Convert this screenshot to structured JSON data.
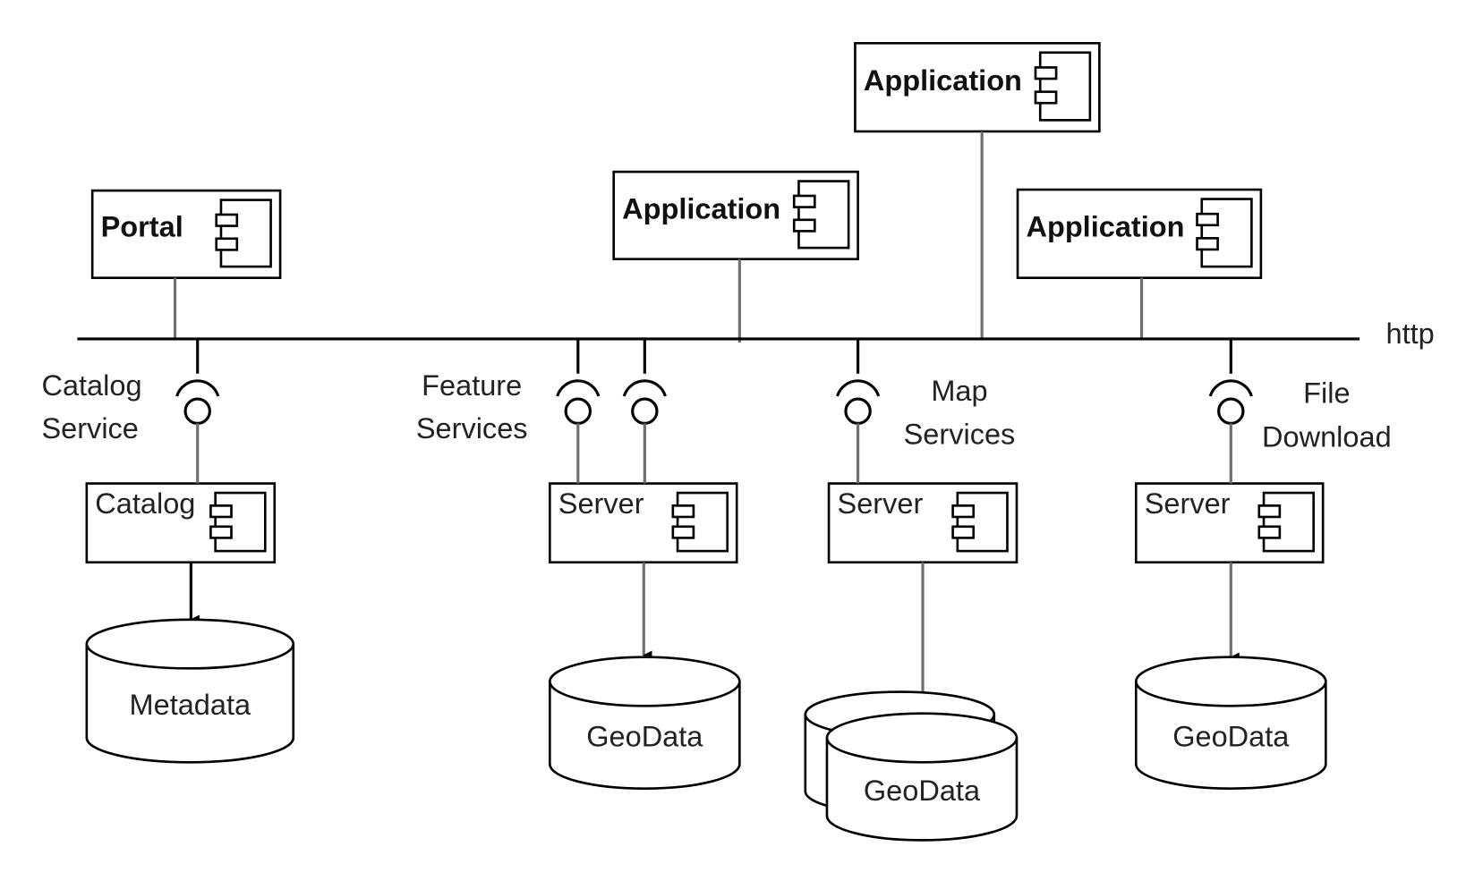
{
  "diagram": {
    "bus_label": "http",
    "applications": [
      {
        "label": "Portal"
      },
      {
        "label": "Application"
      },
      {
        "label": "Application"
      },
      {
        "label": "Application"
      }
    ],
    "interfaces": [
      {
        "line1": "Catalog",
        "line2": "Service"
      },
      {
        "line1": "Feature",
        "line2": "Services"
      },
      {
        "line1": "Map",
        "line2": "Services"
      },
      {
        "line1": "File",
        "line2": "Download"
      }
    ],
    "servers": [
      {
        "label": "Catalog"
      },
      {
        "label": "Server"
      },
      {
        "label": "Server"
      },
      {
        "label": "Server"
      }
    ],
    "datastores": [
      {
        "label": "Metadata"
      },
      {
        "label": "GeoData"
      },
      {
        "label": "GeoData"
      },
      {
        "label": "GeoData"
      }
    ],
    "icon": "uml-component-icon"
  }
}
